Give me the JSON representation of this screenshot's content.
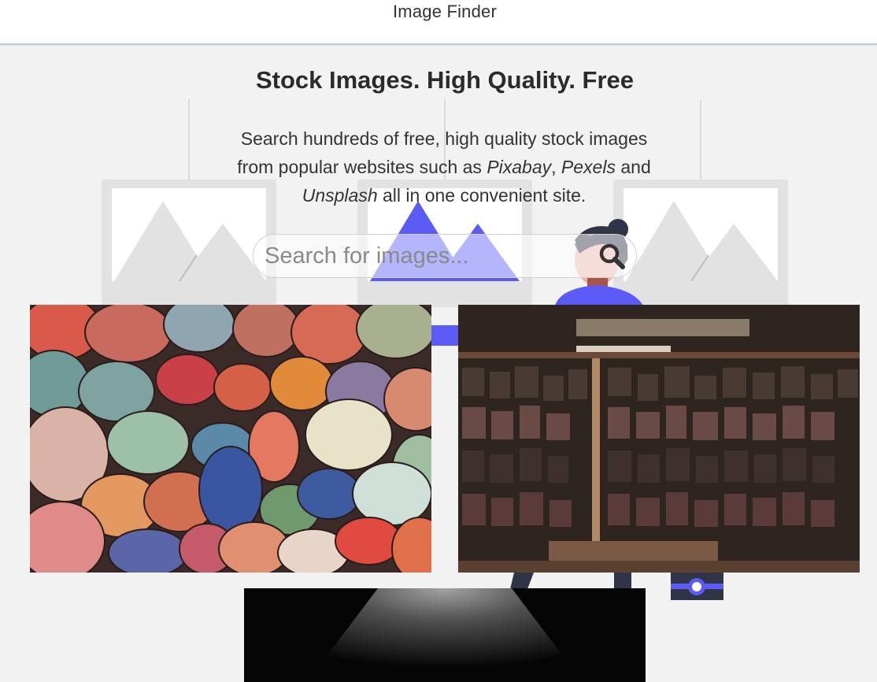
{
  "app": {
    "title": "Image Finder"
  },
  "hero": {
    "headline": "Stock Images. High Quality. Free",
    "line1": "Search hundreds of free, high quality stock images",
    "line2_prefix": "from popular websites such as ",
    "site1": "Pixabay",
    "sep": ", ",
    "site2": "Pexels",
    "line2_suffix": " and",
    "site3": "Unsplash",
    "line3_suffix": " all in one convenient site."
  },
  "search": {
    "placeholder": "Search for images...",
    "icon": "search-icon"
  },
  "results": [
    {
      "subject": "colorful painted pebbles"
    },
    {
      "subject": "wooden letterpress type blocks"
    },
    {
      "subject": "dark spotlight"
    }
  ],
  "colors": {
    "accent": "#5b5bf5",
    "navy": "#2f3447",
    "frame": "#e2e2e2"
  }
}
